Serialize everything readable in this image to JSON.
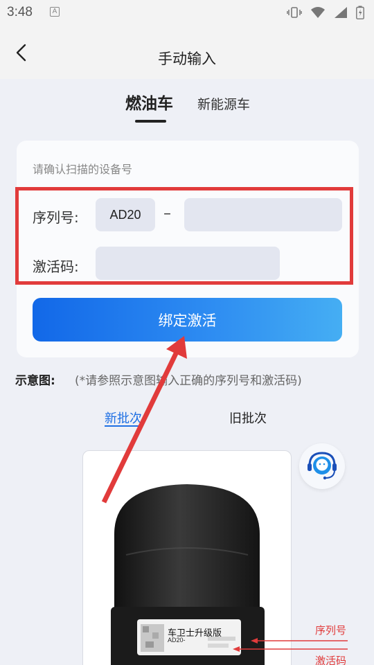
{
  "status_bar": {
    "time": "3:48",
    "notif_glyph": "A",
    "icons": [
      "vibrate-icon",
      "wifi-icon",
      "signal-icon",
      "battery-icon"
    ]
  },
  "header": {
    "title": "手动输入",
    "back_icon": "chevron-left-icon"
  },
  "tabs": [
    {
      "label": "燃油车",
      "active": true
    },
    {
      "label": "新能源车",
      "active": false
    }
  ],
  "form": {
    "hint": "请确认扫描的设备号",
    "serial_label": "序列号:",
    "serial_prefix": "AD20",
    "dash": "–",
    "serial_value": "",
    "activation_label": "激活码:",
    "activation_value": "",
    "bind_button": "绑定激活"
  },
  "diagram": {
    "title": "示意图:",
    "note": "(*请参照示意图输入正确的序列号和激活码)",
    "batches": [
      {
        "label": "新批次",
        "active": true
      },
      {
        "label": "旧批次",
        "active": false
      }
    ],
    "device_label_title": "车卫士升级版",
    "device_label_serial_prefix": "AD20-",
    "callout_serial": "序列号",
    "callout_activation": "激活码"
  },
  "colors": {
    "accent": "#1e6fe3",
    "annotation_red": "#e13b3b",
    "background": "#eef0f6",
    "field_bg": "#e3e6f0"
  }
}
